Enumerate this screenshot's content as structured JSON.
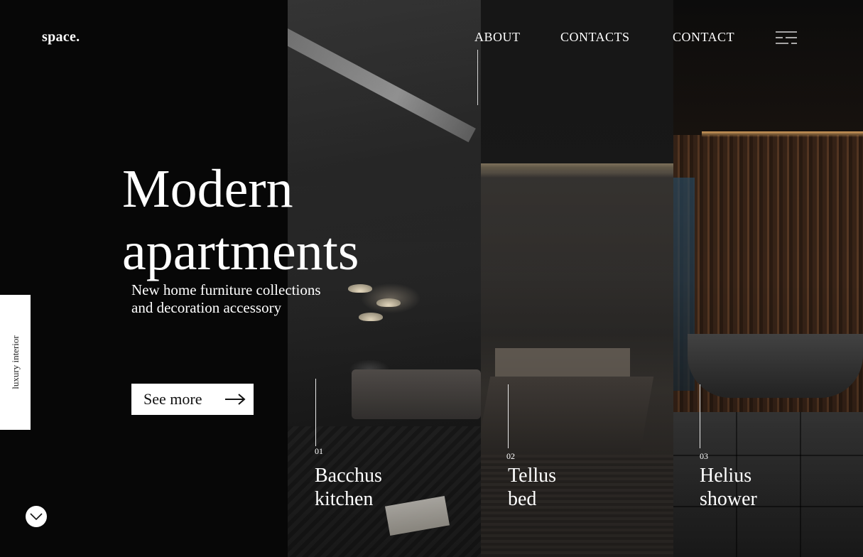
{
  "header": {
    "logo": "space.",
    "nav": [
      "ABOUT",
      "CONTACTS",
      "CONTACT"
    ]
  },
  "hero": {
    "title_line1": "Modern",
    "title_line2": "apartments",
    "subtitle": "New home furniture collections and decoration accessory",
    "cta_label": "See more"
  },
  "side_tab": {
    "label": "luxury interior"
  },
  "panels": [
    {
      "number": "01",
      "line1": "Bacchus",
      "line2": "kitchen"
    },
    {
      "number": "02",
      "line1": "Tellus",
      "line2": "bed"
    },
    {
      "number": "03",
      "line1": "Helius",
      "line2": "shower"
    }
  ],
  "icons": {
    "menu": "menu-icon",
    "arrow": "arrow-right-icon",
    "scroll": "chevron-down-icon"
  },
  "colors": {
    "background": "#070707",
    "text": "#ffffff",
    "button": "#ffffff"
  }
}
